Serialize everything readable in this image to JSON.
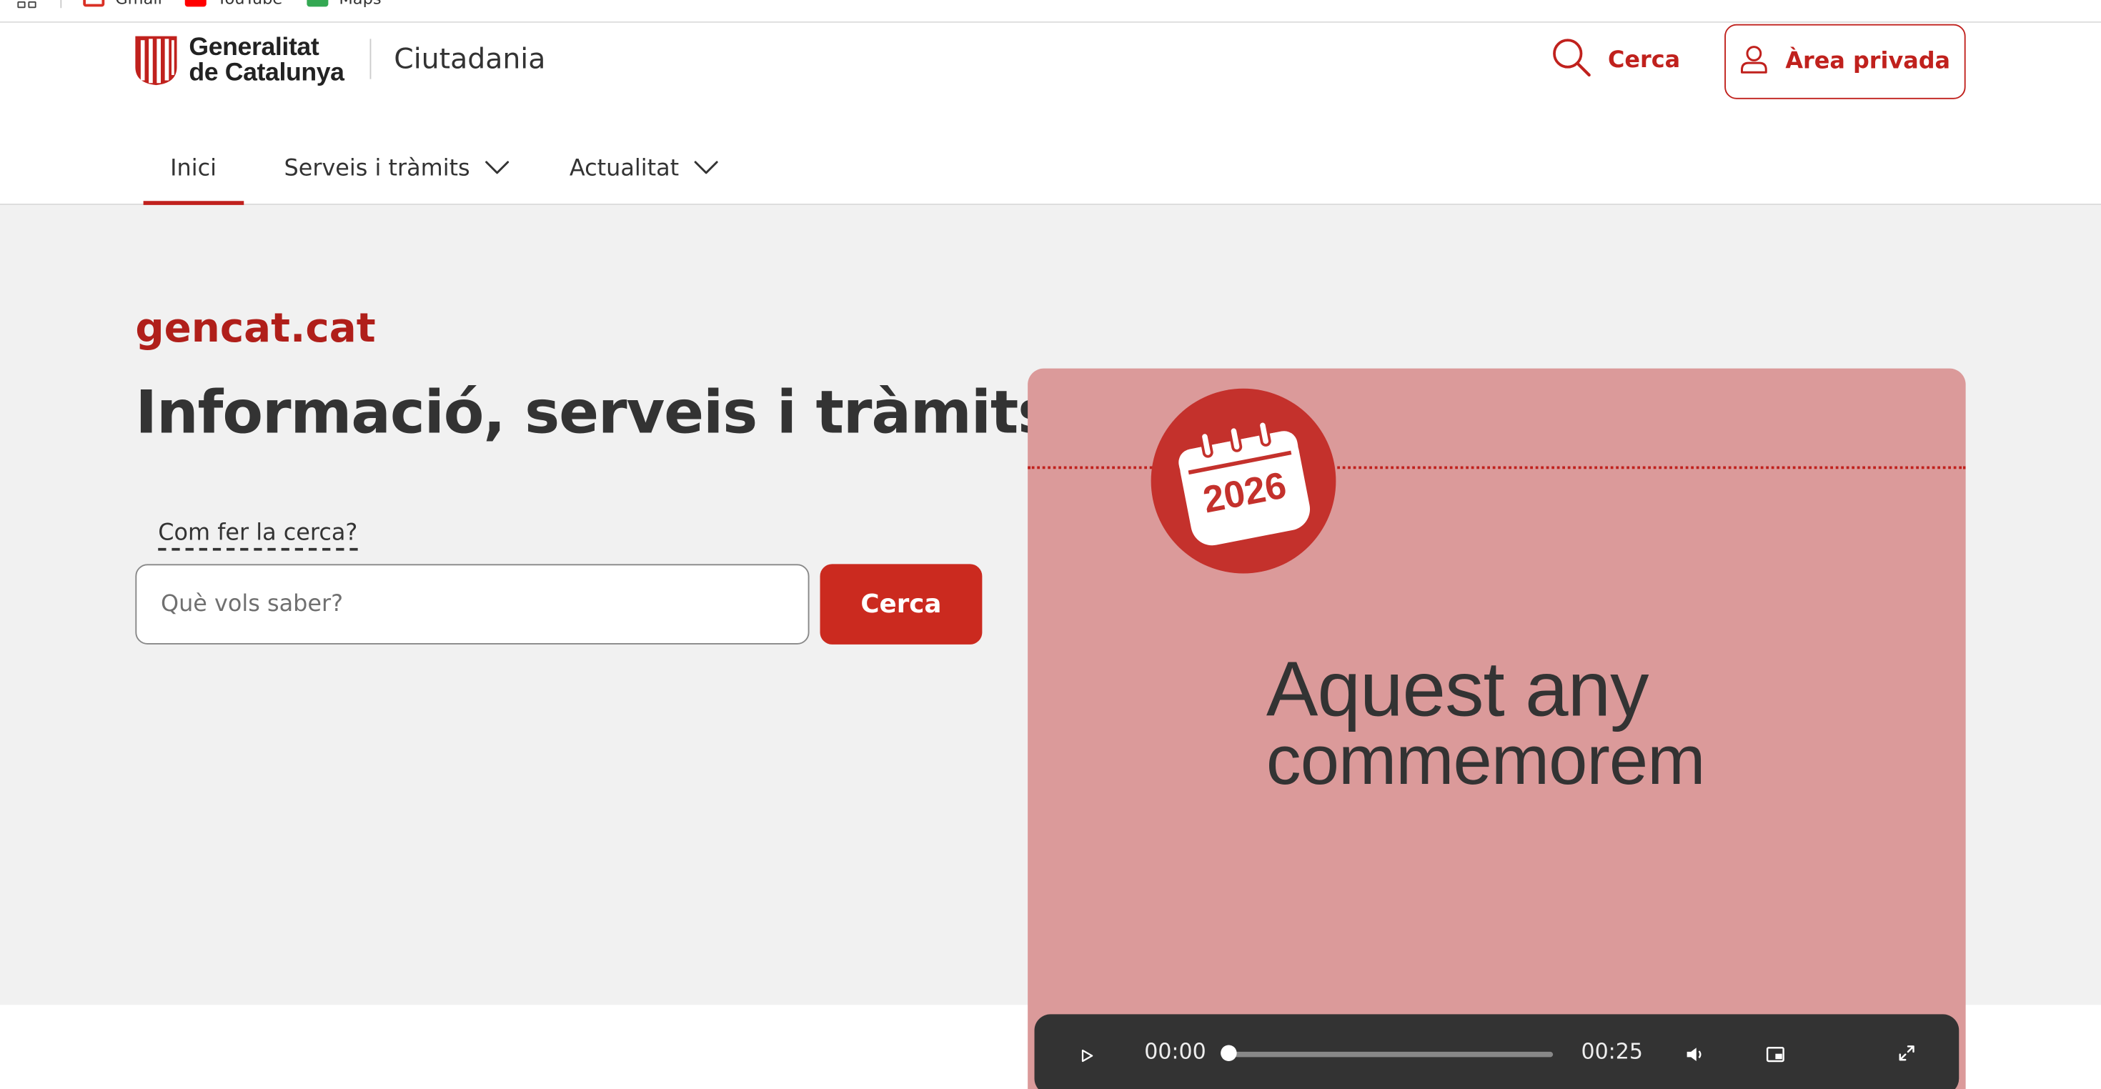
{
  "bookmarks": {
    "items": [
      {
        "label": "Gmail",
        "icon": "gmail-icon"
      },
      {
        "label": "YouTube",
        "icon": "youtube-icon"
      },
      {
        "label": "Maps",
        "icon": "maps-icon"
      }
    ]
  },
  "header": {
    "logo": {
      "line1": "Generalitat",
      "line2": "de Catalunya"
    },
    "site_name": "Ciutadania",
    "search_label": "Cerca",
    "private_area_label": "Àrea privada"
  },
  "nav": {
    "items": [
      {
        "label": "Inici",
        "active": true
      },
      {
        "label": "Serveis i tràmits",
        "has_dropdown": true
      },
      {
        "label": "Actualitat",
        "has_dropdown": true
      }
    ]
  },
  "hero": {
    "brand": "gencat.cat",
    "title": "Informació, serveis i tràmits",
    "help_link": "Com fer la cerca?",
    "search": {
      "placeholder": "Què vols saber?",
      "value": "",
      "button_label": "Cerca"
    }
  },
  "video": {
    "badge_year": "2026",
    "headline_line1": "Aquest any",
    "headline_line2": "commemorem",
    "current_time": "00:00",
    "duration": "00:25",
    "progress": 0
  },
  "colors": {
    "brand_red": "#c0211d",
    "button_red": "#cb2a1f",
    "hero_background": "#f1f1f1",
    "video_background": "#db9a9a",
    "controls_background": "#333333"
  }
}
